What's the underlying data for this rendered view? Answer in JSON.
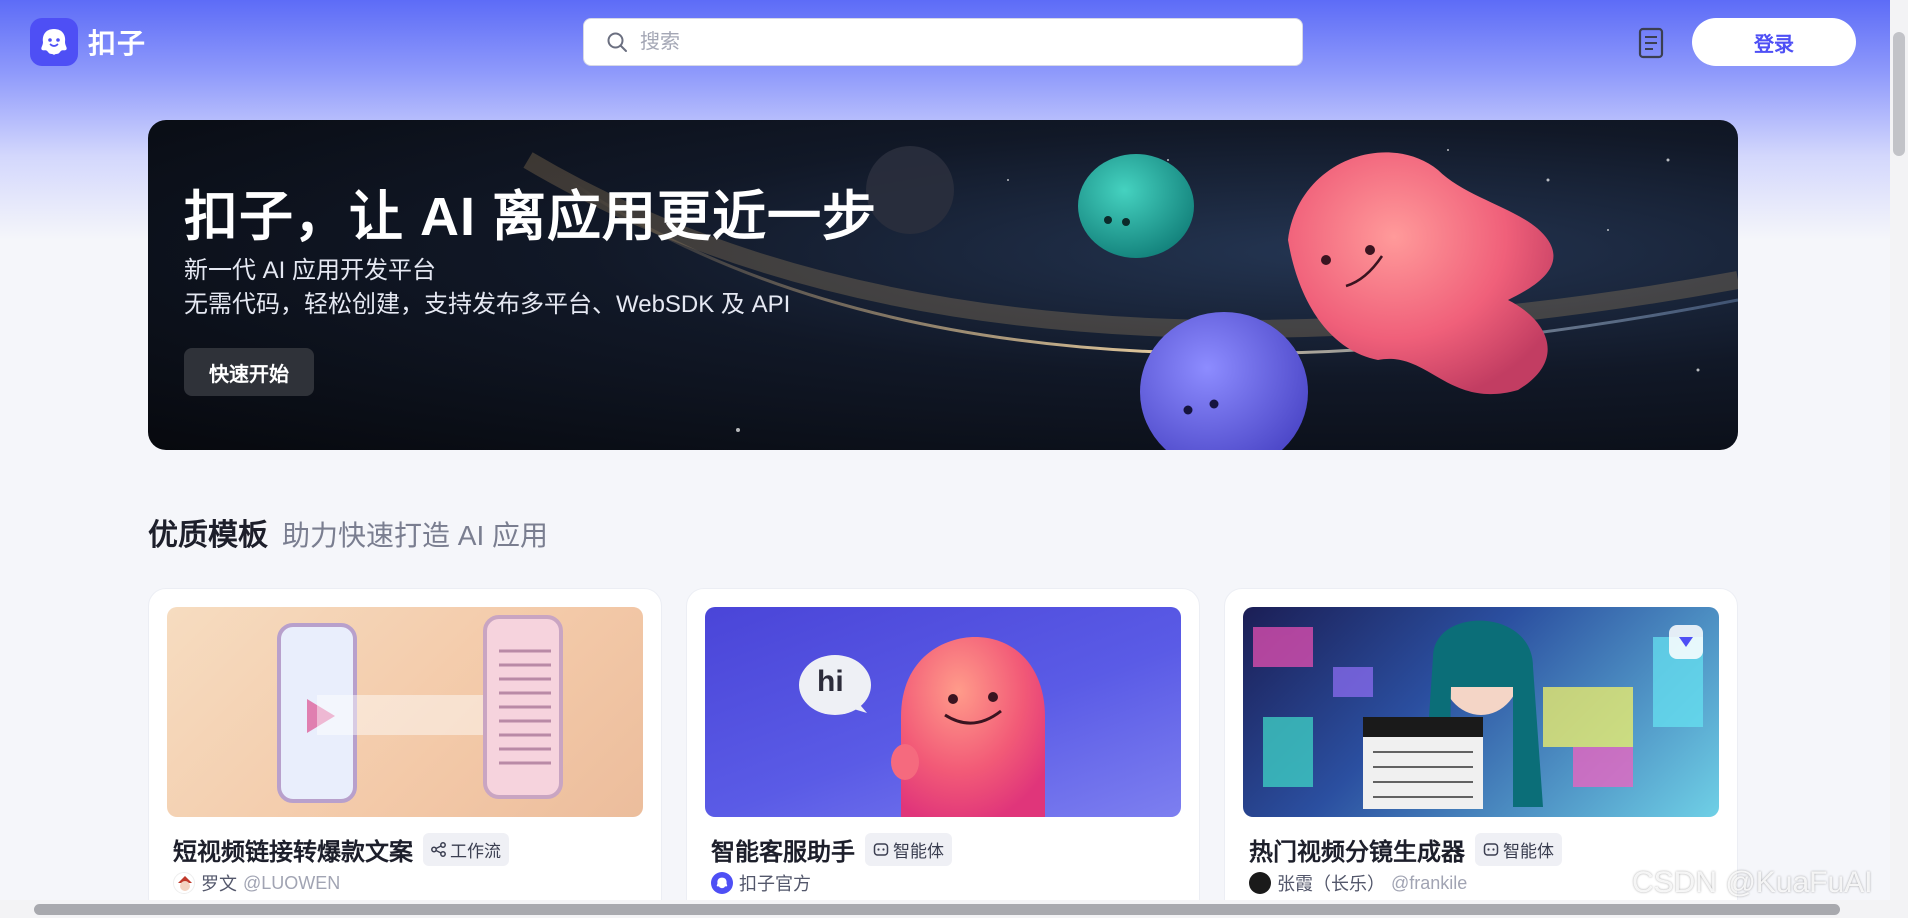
{
  "app": {
    "name": "扣子"
  },
  "header": {
    "search_placeholder": "搜索",
    "login_label": "登录"
  },
  "banner": {
    "title": "扣子，让 AI 离应用更近一步",
    "subtitle_line1": "新一代 AI 应用开发平台",
    "subtitle_line2": "无需代码，轻松创建，支持发布多平台、WebSDK 及 API",
    "cta_label": "快速开始"
  },
  "section": {
    "title": "优质模板",
    "subtitle": "助力快速打造 AI 应用"
  },
  "cards": [
    {
      "title": "短视频链接转爆款文案",
      "tag": "工作流",
      "tag_icon": "workflow-icon",
      "author": "罗文",
      "handle": "@LUOWEN"
    },
    {
      "title": "智能客服助手",
      "tag": "智能体",
      "tag_icon": "bot-icon",
      "author": "扣子官方",
      "handle": "",
      "image_text": "hi"
    },
    {
      "title": "热门视频分镜生成器",
      "tag": "智能体",
      "tag_icon": "bot-icon",
      "author": "张霞（长乐）",
      "handle": "@frankile"
    }
  ],
  "watermark": "CSDN @KuaFuAI",
  "colors": {
    "brand": "#4e4ff5",
    "header_gradient": "#5d6cf7",
    "page_bg": "#f5f6fa"
  }
}
